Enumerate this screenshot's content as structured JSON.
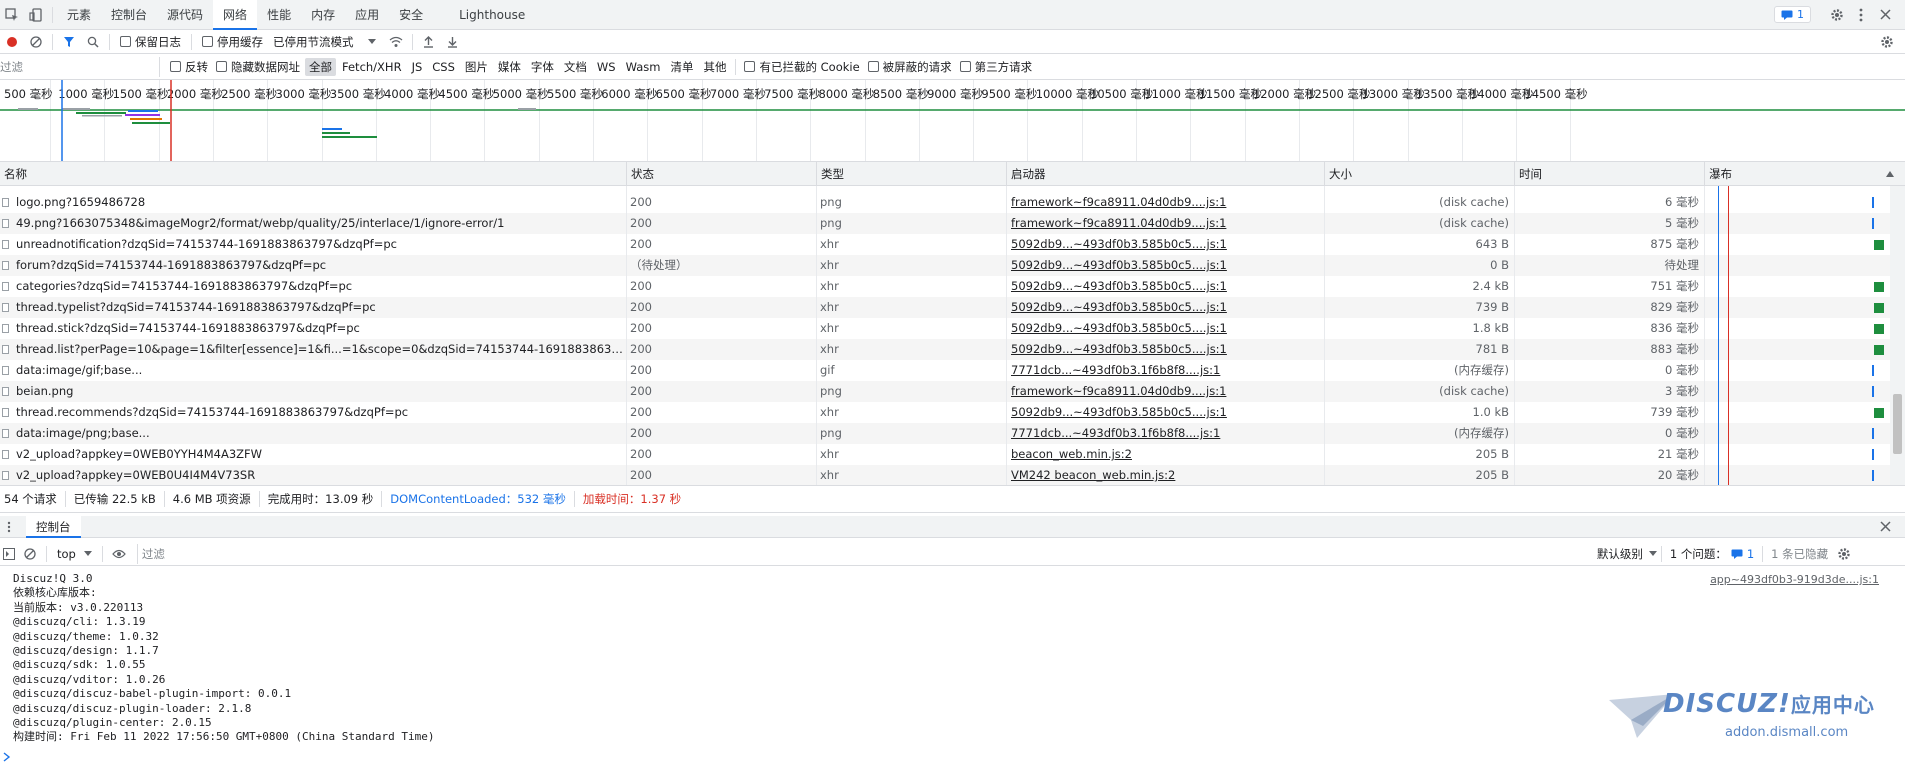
{
  "tabs": [
    "元素",
    "控制台",
    "源代码",
    "网络",
    "性能",
    "内存",
    "应用",
    "安全",
    "Lighthouse"
  ],
  "active_tab": "网络",
  "issues_count": "1",
  "toolbar": {
    "preserve_log": "保留日志",
    "disable_cache": "停用缓存",
    "throttle": "已停用节流模式"
  },
  "filter": {
    "placeholder": "过滤",
    "invert": "反转",
    "hide_data_urls": "隐藏数据网址",
    "types": [
      "全部",
      "Fetch/XHR",
      "JS",
      "CSS",
      "图片",
      "媒体",
      "字体",
      "文档",
      "WS",
      "Wasm",
      "清单",
      "其他"
    ],
    "blocked_cookies": "有已拦截的 Cookie",
    "blocked_requests": "被屏蔽的请求",
    "third_party": "第三方请求"
  },
  "overview_ticks": [
    "500 毫秒",
    "1000 毫秒",
    "1500 毫秒",
    "2000 毫秒",
    "2500 毫秒",
    "3000 毫秒",
    "3500 毫秒",
    "4000 毫秒",
    "4500 毫秒",
    "5000 毫秒",
    "5500 毫秒",
    "6000 毫秒",
    "6500 毫秒",
    "7000 毫秒",
    "7500 毫秒",
    "8000 毫秒",
    "8500 毫秒",
    "9000 毫秒",
    "9500 毫秒",
    "10000 毫秒",
    "10500 毫秒",
    "11000 毫秒",
    "11500 毫秒",
    "12000 毫秒",
    "12500 毫秒",
    "13000 毫秒",
    "13500 毫秒",
    "14000 毫秒",
    "14500 毫秒"
  ],
  "columns": {
    "name": "名称",
    "status": "状态",
    "type": "类型",
    "initiator": "启动器",
    "size": "大小",
    "time": "时间",
    "waterfall": "瀑布"
  },
  "requests": [
    {
      "name": "logo.png?1659486728",
      "status": "200",
      "type": "png",
      "initiator": "framework~f9ca8911.04d0db9....js:1",
      "size": "(disk cache)",
      "time": "6 毫秒"
    },
    {
      "name": "49.png?1663075348&imageMogr2/format/webp/quality/25/interlace/1/ignore-error/1",
      "status": "200",
      "type": "png",
      "initiator": "framework~f9ca8911.04d0db9....js:1",
      "size": "(disk cache)",
      "time": "5 毫秒"
    },
    {
      "name": "unreadnotification?dzqSid=74153744-1691883863797&dzqPf=pc",
      "status": "200",
      "type": "xhr",
      "initiator": "5092db9...~493df0b3.585b0c5....js:1",
      "size": "643 B",
      "time": "875 毫秒"
    },
    {
      "name": "forum?dzqSid=74153744-1691883863797&dzqPf=pc",
      "status": "（待处理）",
      "type": "xhr",
      "initiator": "5092db9...~493df0b3.585b0c5....js:1",
      "size": "0 B",
      "time": "待处理"
    },
    {
      "name": "categories?dzqSid=74153744-1691883863797&dzqPf=pc",
      "status": "200",
      "type": "xhr",
      "initiator": "5092db9...~493df0b3.585b0c5....js:1",
      "size": "2.4 kB",
      "time": "751 毫秒"
    },
    {
      "name": "thread.typelist?dzqSid=74153744-1691883863797&dzqPf=pc",
      "status": "200",
      "type": "xhr",
      "initiator": "5092db9...~493df0b3.585b0c5....js:1",
      "size": "739 B",
      "time": "829 毫秒"
    },
    {
      "name": "thread.stick?dzqSid=74153744-1691883863797&dzqPf=pc",
      "status": "200",
      "type": "xhr",
      "initiator": "5092db9...~493df0b3.585b0c5....js:1",
      "size": "1.8 kB",
      "time": "836 毫秒"
    },
    {
      "name": "thread.list?perPage=10&page=1&filter[essence]=1&fi...=1&scope=0&dzqSid=74153744-1691883863797&dzqP...",
      "status": "200",
      "type": "xhr",
      "initiator": "5092db9...~493df0b3.585b0c5....js:1",
      "size": "781 B",
      "time": "883 毫秒"
    },
    {
      "name": "data:image/gif;base...",
      "status": "200",
      "type": "gif",
      "initiator": "7771dcb...~493df0b3.1f6b8f8....js:1",
      "size": "(内存缓存)",
      "time": "0 毫秒"
    },
    {
      "name": "beian.png",
      "status": "200",
      "type": "png",
      "initiator": "framework~f9ca8911.04d0db9....js:1",
      "size": "(disk cache)",
      "time": "3 毫秒"
    },
    {
      "name": "thread.recommends?dzqSid=74153744-1691883863797&dzqPf=pc",
      "status": "200",
      "type": "xhr",
      "initiator": "5092db9...~493df0b3.585b0c5....js:1",
      "size": "1.0 kB",
      "time": "739 毫秒"
    },
    {
      "name": "data:image/png;base...",
      "status": "200",
      "type": "png",
      "initiator": "7771dcb...~493df0b3.1f6b8f8....js:1",
      "size": "(内存缓存)",
      "time": "0 毫秒"
    },
    {
      "name": "v2_upload?appkey=0WEB0YYH4M4A3ZFW",
      "status": "200",
      "type": "xhr",
      "initiator": "beacon_web.min.js:2",
      "size": "205 B",
      "time": "21 毫秒"
    },
    {
      "name": "v2_upload?appkey=0WEB0U4I4M4V73SR",
      "status": "200",
      "type": "xhr",
      "initiator": "VM242 beacon_web.min.js:2",
      "size": "205 B",
      "time": "20 毫秒"
    }
  ],
  "summary": {
    "requests": "54 个请求",
    "transferred": "已传输 22.5 kB",
    "resources": "4.6 MB 项资源",
    "finish": "完成用时：13.09 秒",
    "dcl": "DOMContentLoaded：532 毫秒",
    "load": "加载时间：1.37 秒"
  },
  "drawer": {
    "tab": "控制台",
    "context": "top",
    "filter_placeholder": "过滤",
    "levels": "默认级别",
    "issues": "1 个问题：",
    "issues_count": "1",
    "hidden": "1 条已隐藏"
  },
  "console": {
    "source": "app~493df0b3-919d3de....js:1",
    "lines": [
      "Discuz!Q 3.0",
      "依赖核心库版本:",
      "当前版本: v3.0.220113",
      "@discuzq/cli: 1.3.19",
      "@discuzq/theme: 1.0.32",
      "@discuzq/design: 1.1.7",
      "@discuzq/sdk: 1.0.55",
      "@discuzq/vditor: 1.0.26",
      "@discuzq/discuz-babel-plugin-import: 0.0.1",
      "@discuzq/discuz-plugin-loader: 2.1.8",
      "@discuzq/plugin-center: 2.0.15",
      "构建时间: Fri Feb 11 2022 17:56:50 GMT+0800 (China Standard Time)"
    ]
  },
  "watermark": {
    "brand": "DISCUZ!",
    "center": "应用中心",
    "url": "addon.dismall.com"
  },
  "colors": {
    "accent": "#1a73e8",
    "waterfall_bar": "#1e8e3e",
    "load_line": "#d93025",
    "record": "#d93025"
  }
}
